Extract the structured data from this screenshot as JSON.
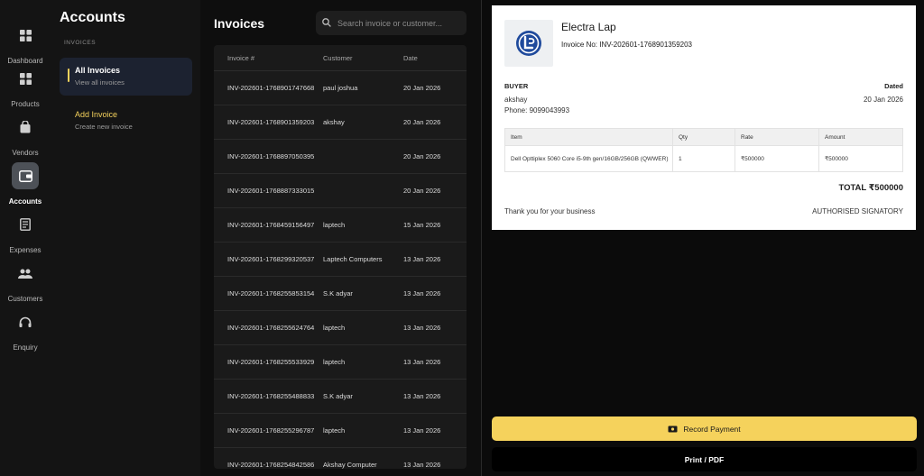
{
  "rail": [
    {
      "key": "dashboard",
      "label": "Dashboard",
      "icon": "dashboard-icon",
      "active": false
    },
    {
      "key": "products",
      "label": "Products",
      "icon": "products-icon",
      "active": false
    },
    {
      "key": "vendors",
      "label": "Vendors",
      "icon": "vendors-icon",
      "active": false
    },
    {
      "key": "accounts",
      "label": "Accounts",
      "icon": "accounts-icon",
      "active": true
    },
    {
      "key": "expenses",
      "label": "Expenses",
      "icon": "expenses-icon",
      "active": false
    },
    {
      "key": "customers",
      "label": "Customers",
      "icon": "customers-icon",
      "active": false
    },
    {
      "key": "enquiry",
      "label": "Enquiry",
      "icon": "enquiry-icon",
      "active": false
    }
  ],
  "subnav": {
    "title": "Accounts",
    "section": "INVOICES",
    "items": [
      {
        "title": "All Invoices",
        "sub": "View all invoices",
        "active": true
      },
      {
        "title": "Add Invoice",
        "sub": "Create new invoice",
        "active": false
      }
    ]
  },
  "list": {
    "title": "Invoices",
    "search_placeholder": "Search invoice or customer...",
    "headers": [
      "Invoice #",
      "Customer",
      "Date"
    ],
    "rows": [
      [
        "INV-202601-1768901747668",
        "paul joshua",
        "20 Jan 2026"
      ],
      [
        "INV-202601-1768901359203",
        "akshay",
        "20 Jan 2026"
      ],
      [
        "INV-202601-1768897050395",
        "",
        "20 Jan 2026"
      ],
      [
        "INV-202601-1768887333015",
        "",
        "20 Jan 2026"
      ],
      [
        "INV-202601-1768459156497",
        "laptech",
        "15 Jan 2026"
      ],
      [
        "INV-202601-1768299320537",
        "Laptech Computers",
        "13 Jan 2026"
      ],
      [
        "INV-202601-1768255853154",
        "S.K adyar",
        "13 Jan 2026"
      ],
      [
        "INV-202601-1768255624764",
        "laptech",
        "13 Jan 2026"
      ],
      [
        "INV-202601-1768255533929",
        "laptech",
        "13 Jan 2026"
      ],
      [
        "INV-202601-1768255488833",
        "S.K adyar",
        "13 Jan 2026"
      ],
      [
        "INV-202601-1768255296787",
        "laptech",
        "13 Jan 2026"
      ],
      [
        "INV-202601-1768254842586",
        "Akshay Computer",
        "13 Jan 2026"
      ]
    ]
  },
  "invoice": {
    "company": "Electra Lap",
    "invoice_no": "Invoice No: INV-202601-1768901359203",
    "buyer_label": "BUYER",
    "buyer_name": "akshay",
    "buyer_phone": "Phone: 9099043993",
    "dated_label": "Dated",
    "dated_value": "20 Jan 2026",
    "item_headers": [
      "Item",
      "Qty",
      "Rate",
      "Amount"
    ],
    "items": [
      [
        "Dell Opttiplex 5060 Core i5-9th gen/16GB/256GB (QWWER)",
        "1",
        "₹500000",
        "₹500000"
      ]
    ],
    "total": "TOTAL ₹500000",
    "thanks": "Thank you for your business",
    "signatory": "AUTHORISED SIGNATORY"
  },
  "actions": {
    "record_payment": "Record Payment",
    "print_pdf": "Print / PDF"
  },
  "colors": {
    "accent_yellow": "#f5d25c",
    "logo_blue": "#1f4a9c",
    "active_rail": "#4d5157"
  }
}
